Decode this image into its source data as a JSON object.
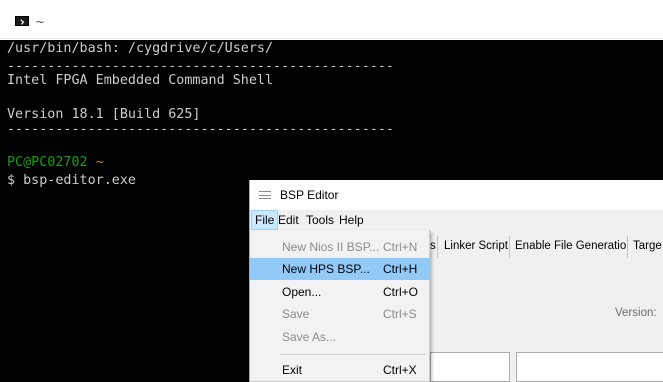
{
  "terminal": {
    "icon": "console-icon",
    "title": "~",
    "lines": [
      "/usr/bin/bash: /cygdrive/c/Users/",
      "------------------------------------------------",
      "Intel FPGA Embedded Command Shell",
      "",
      "Version 18.1 [Build 625]",
      "------------------------------------------------",
      "",
      "",
      "$ bsp-editor.exe"
    ],
    "prompt_user": "PC@PC02702",
    "prompt_path": "~",
    "colors": {
      "background": "#000000",
      "text": "#cccccc",
      "prompt_user": "#13a10e",
      "prompt_path": "#c19c00"
    }
  },
  "bsp_editor": {
    "title": "BSP Editor",
    "app_icon": "bsp-app-icon",
    "menu": [
      "File",
      "Edit",
      "Tools",
      "Help"
    ],
    "active_menu": "File",
    "tabs": [
      "s",
      "Linker Script",
      "Enable File Generation",
      "Targe"
    ],
    "version_label": "Version:",
    "file_menu": [
      {
        "label": "New Nios II BSP...",
        "shortcut": "Ctrl+N",
        "state": "disabled"
      },
      {
        "label": "New HPS BSP...",
        "shortcut": "Ctrl+H",
        "state": "highlighted"
      },
      {
        "label": "Open...",
        "shortcut": "Ctrl+O",
        "state": "enabled"
      },
      {
        "label": "Save",
        "shortcut": "Ctrl+S",
        "state": "disabled"
      },
      {
        "label": "Save As...",
        "shortcut": "",
        "state": "disabled"
      },
      {
        "label": "Exit",
        "shortcut": "Ctrl+X",
        "state": "enabled"
      }
    ],
    "colors": {
      "highlight": "#91c9f7",
      "menu_active": "#cce8ff",
      "disabled_text": "#8c8c8c"
    }
  }
}
